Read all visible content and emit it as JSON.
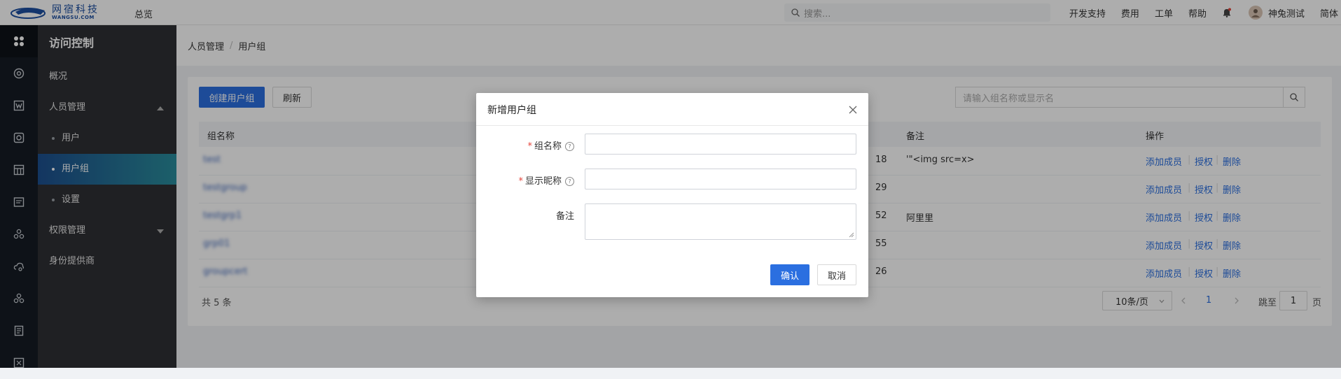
{
  "topbar": {
    "logo_cn": "网宿科技",
    "logo_en": "WANGSU.COM",
    "overview": "总览",
    "search_placeholder": "搜索...",
    "links": [
      "开发支持",
      "费用",
      "工单",
      "帮助"
    ],
    "username": "神兔测试",
    "language": "简体"
  },
  "sidebar": {
    "title": "访问控制",
    "overview": "概况",
    "people_mgmt": "人员管理",
    "sub_users": "用户",
    "sub_groups": "用户组",
    "sub_settings": "设置",
    "perm_mgmt": "权限管理",
    "idp": "身份提供商"
  },
  "breadcrumb": {
    "root": "人员管理",
    "sep": "/",
    "current": "用户组"
  },
  "toolbar": {
    "create_button": "创建用户组",
    "refresh_button": "刷新",
    "search_placeholder": "请输入组名称或显示名"
  },
  "table": {
    "headers": {
      "name": "组名称",
      "remark": "备注",
      "actions": "操作"
    },
    "rows": [
      {
        "name": "test",
        "time_tail": "18",
        "remark": "'\"<img src=x>"
      },
      {
        "name": "testgroup",
        "time_tail": "29",
        "remark": ""
      },
      {
        "name": "testgrp1",
        "time_tail": "52",
        "remark": "阿里里"
      },
      {
        "name": "grp01",
        "time_tail": "55",
        "remark": ""
      },
      {
        "name": "groupcert",
        "time_tail": "26",
        "remark": ""
      }
    ],
    "action_labels": {
      "add_member": "添加成员",
      "authorize": "授权",
      "delete": "删除"
    }
  },
  "pagination": {
    "total": "共 5 条",
    "page_size": "10条/页",
    "current_page": "1",
    "jump_label": "跳至",
    "jump_value": "1",
    "page_unit": "页"
  },
  "dialog": {
    "title": "新增用户组",
    "field_group_name": "组名称",
    "field_display_name": "显示昵称",
    "field_remark": "备注",
    "required_mark": "*",
    "help_mark": "?",
    "confirm_button": "确认",
    "cancel_button": "取消"
  },
  "colors": {
    "accent": "#2b6fe0",
    "sidebar_bg": "#2f3034",
    "iconbar_bg": "#151b24",
    "required": "#e5443b"
  }
}
